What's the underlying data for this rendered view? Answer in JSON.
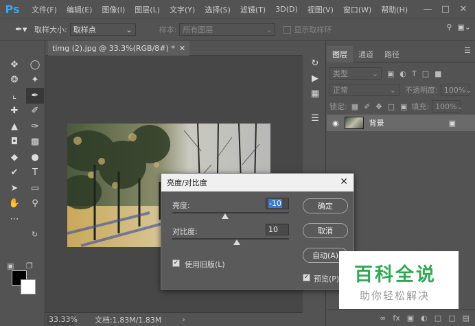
{
  "app": {
    "logo": "Ps"
  },
  "menu": [
    "文件(F)",
    "编辑(E)",
    "图像(I)",
    "图层(L)",
    "文字(Y)",
    "选择(S)",
    "滤镜(T)",
    "3D(D)",
    "视图(V)",
    "窗口(W)",
    "帮助(H)"
  ],
  "options": {
    "sample_size_label": "取样大小:",
    "sample_size_value": "取样点",
    "sample_label": "样本:",
    "sample_value": "所有图层",
    "show_ring_label": "显示取样环"
  },
  "document": {
    "tab_title": "timg (2).jpg @ 33.3%(RGB/8#) *",
    "zoom": "33.33%",
    "doc_info": "文档:1.83M/1.83M"
  },
  "layers_panel": {
    "tabs": [
      "图层",
      "通道",
      "路径"
    ],
    "filter_kind": "类型",
    "blend_mode": "正常",
    "opacity_label": "不透明度:",
    "opacity_value": "100%",
    "lock_label": "锁定:",
    "fill_label": "填充:",
    "fill_value": "100%",
    "layer_name": "背景"
  },
  "dialog": {
    "title": "亮度/对比度",
    "brightness_label": "亮度:",
    "brightness_value": "-10",
    "brightness_level": 0.45,
    "contrast_label": "对比度:",
    "contrast_value": "10",
    "contrast_level": 0.55,
    "legacy_label": "使用旧版(L)",
    "ok_label": "确定",
    "cancel_label": "取消",
    "auto_label": "自动(A)",
    "preview_label": "预览(P)"
  },
  "watermark": {
    "main": "百科全说",
    "sub": "助你轻松解决"
  },
  "colors": {
    "foreground": "#000000",
    "background": "#ffffff",
    "watermark_green": "#2eaa54"
  }
}
